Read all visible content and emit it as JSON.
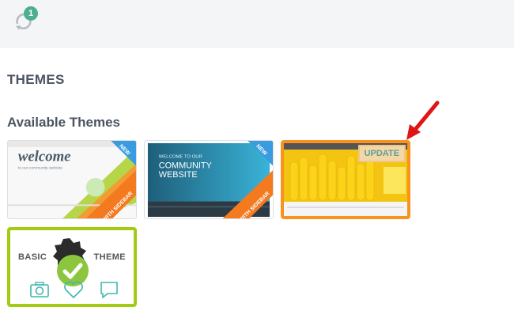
{
  "header": {
    "sync_badge_count": "1",
    "sync_icon": "sync-icon"
  },
  "page": {
    "title": "THEMES",
    "section_title": "Available Themes"
  },
  "themes": [
    {
      "headline": "welcome",
      "tagline": "to our community website",
      "new_badge": "NEW",
      "ribbon": "WITH SIDEBAR"
    },
    {
      "headline_line1": "WELCOME TO OUR",
      "headline_line2": "COMMUNITY",
      "headline_line3": "WEBSITE",
      "new_badge": "NEW",
      "ribbon": "WITH SIDEBAR"
    },
    {
      "update_label": "UPDATE",
      "selected_color": "#f7931e"
    },
    {
      "name_left": "BASIC",
      "name_right": "THEME",
      "active_color": "#a2cc13",
      "icons": [
        "camera-icon",
        "heart-icon",
        "comment-icon"
      ]
    }
  ],
  "colors": {
    "accent_green": "#4caf8e",
    "orange": "#f7931e",
    "lime": "#a2cc13",
    "teal": "#3fb8af"
  }
}
